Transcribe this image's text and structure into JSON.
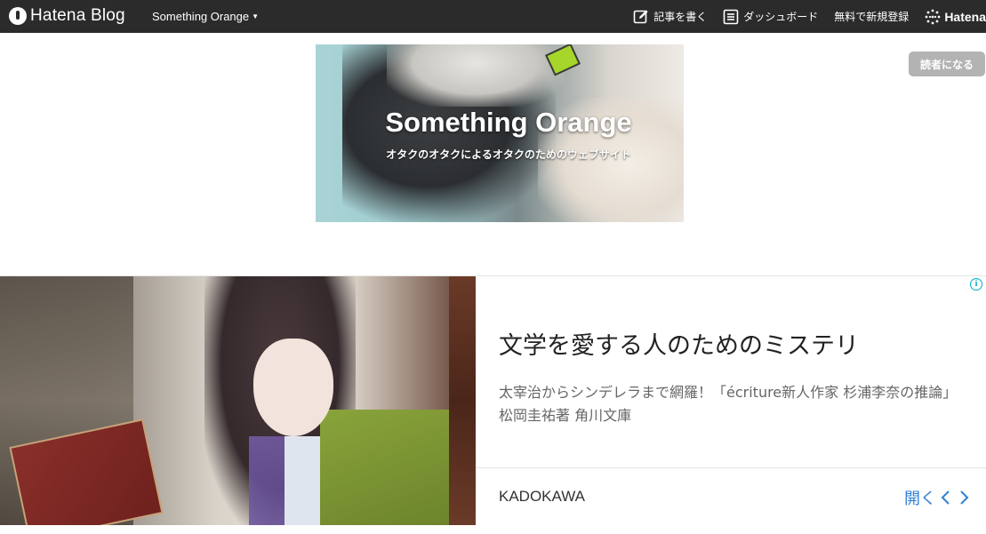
{
  "topbar": {
    "logo_text": "Hatena Blog",
    "blog_name": "Something Orange",
    "write_label": "記事を書く",
    "dashboard_label": "ダッシュボード",
    "signup_label": "無料で新規登録",
    "hatena_label": "Hatena"
  },
  "banner": {
    "title": "Something Orange",
    "subtitle": "オタクのオタクによるオタクのためのウェブサイト"
  },
  "subscribe_label": "読者になる",
  "ad": {
    "info_glyph": "i",
    "headline": "文学を愛する人のためのミステリ",
    "description": "太宰治からシンデレラまで網羅！「écriture新人作家 杉浦李奈の推論」松岡圭祐著 角川文庫",
    "advertiser": "KADOKAWA",
    "open_label": "開く"
  },
  "colors": {
    "topbar_bg": "#2b2b2b",
    "subscribe_bg": "#b3b3b3",
    "ad_link": "#2f80d8",
    "ad_info": "#00aecd"
  }
}
